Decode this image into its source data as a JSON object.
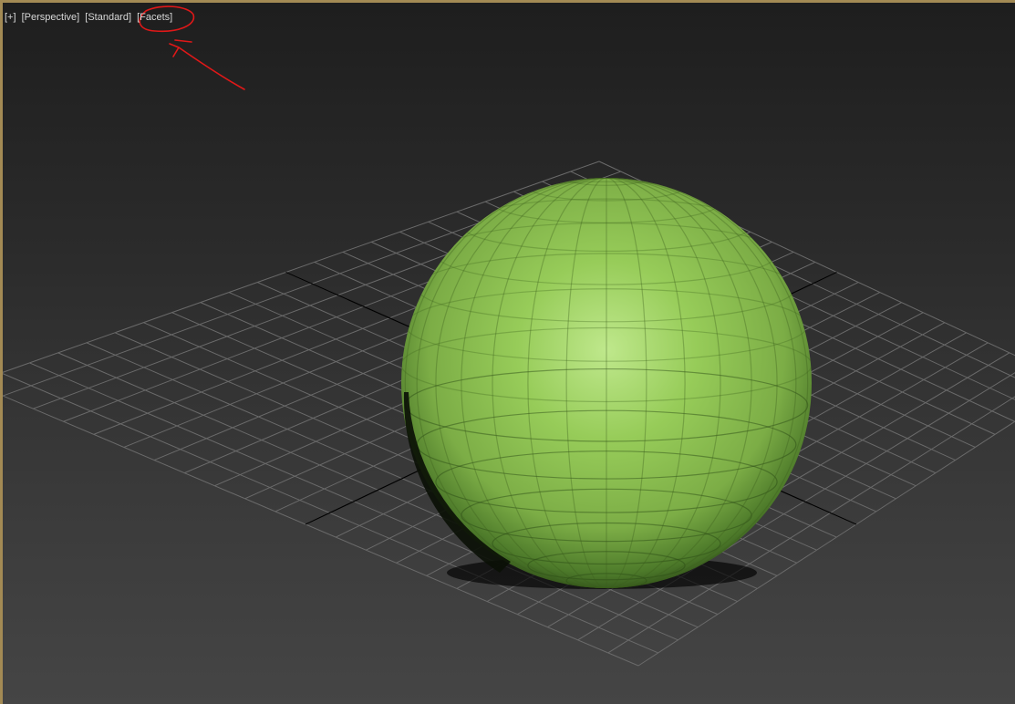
{
  "viewport": {
    "menus": [
      {
        "id": "general",
        "label": "[+]"
      },
      {
        "id": "point-of-view",
        "label": "[Perspective]"
      },
      {
        "id": "shading-mode",
        "label": "[Standard]"
      },
      {
        "id": "display-mode",
        "label": "[Facets]"
      }
    ],
    "object": {
      "type": "sphere",
      "color": "#8ec24e",
      "shading": "facets"
    },
    "grid": {
      "visible": true,
      "line_color": "#6a6a6a",
      "axis_color": "#000000"
    },
    "annotation": {
      "color": "#e01818",
      "shape": "hand-drawn circle and arrow around display mode label"
    }
  }
}
